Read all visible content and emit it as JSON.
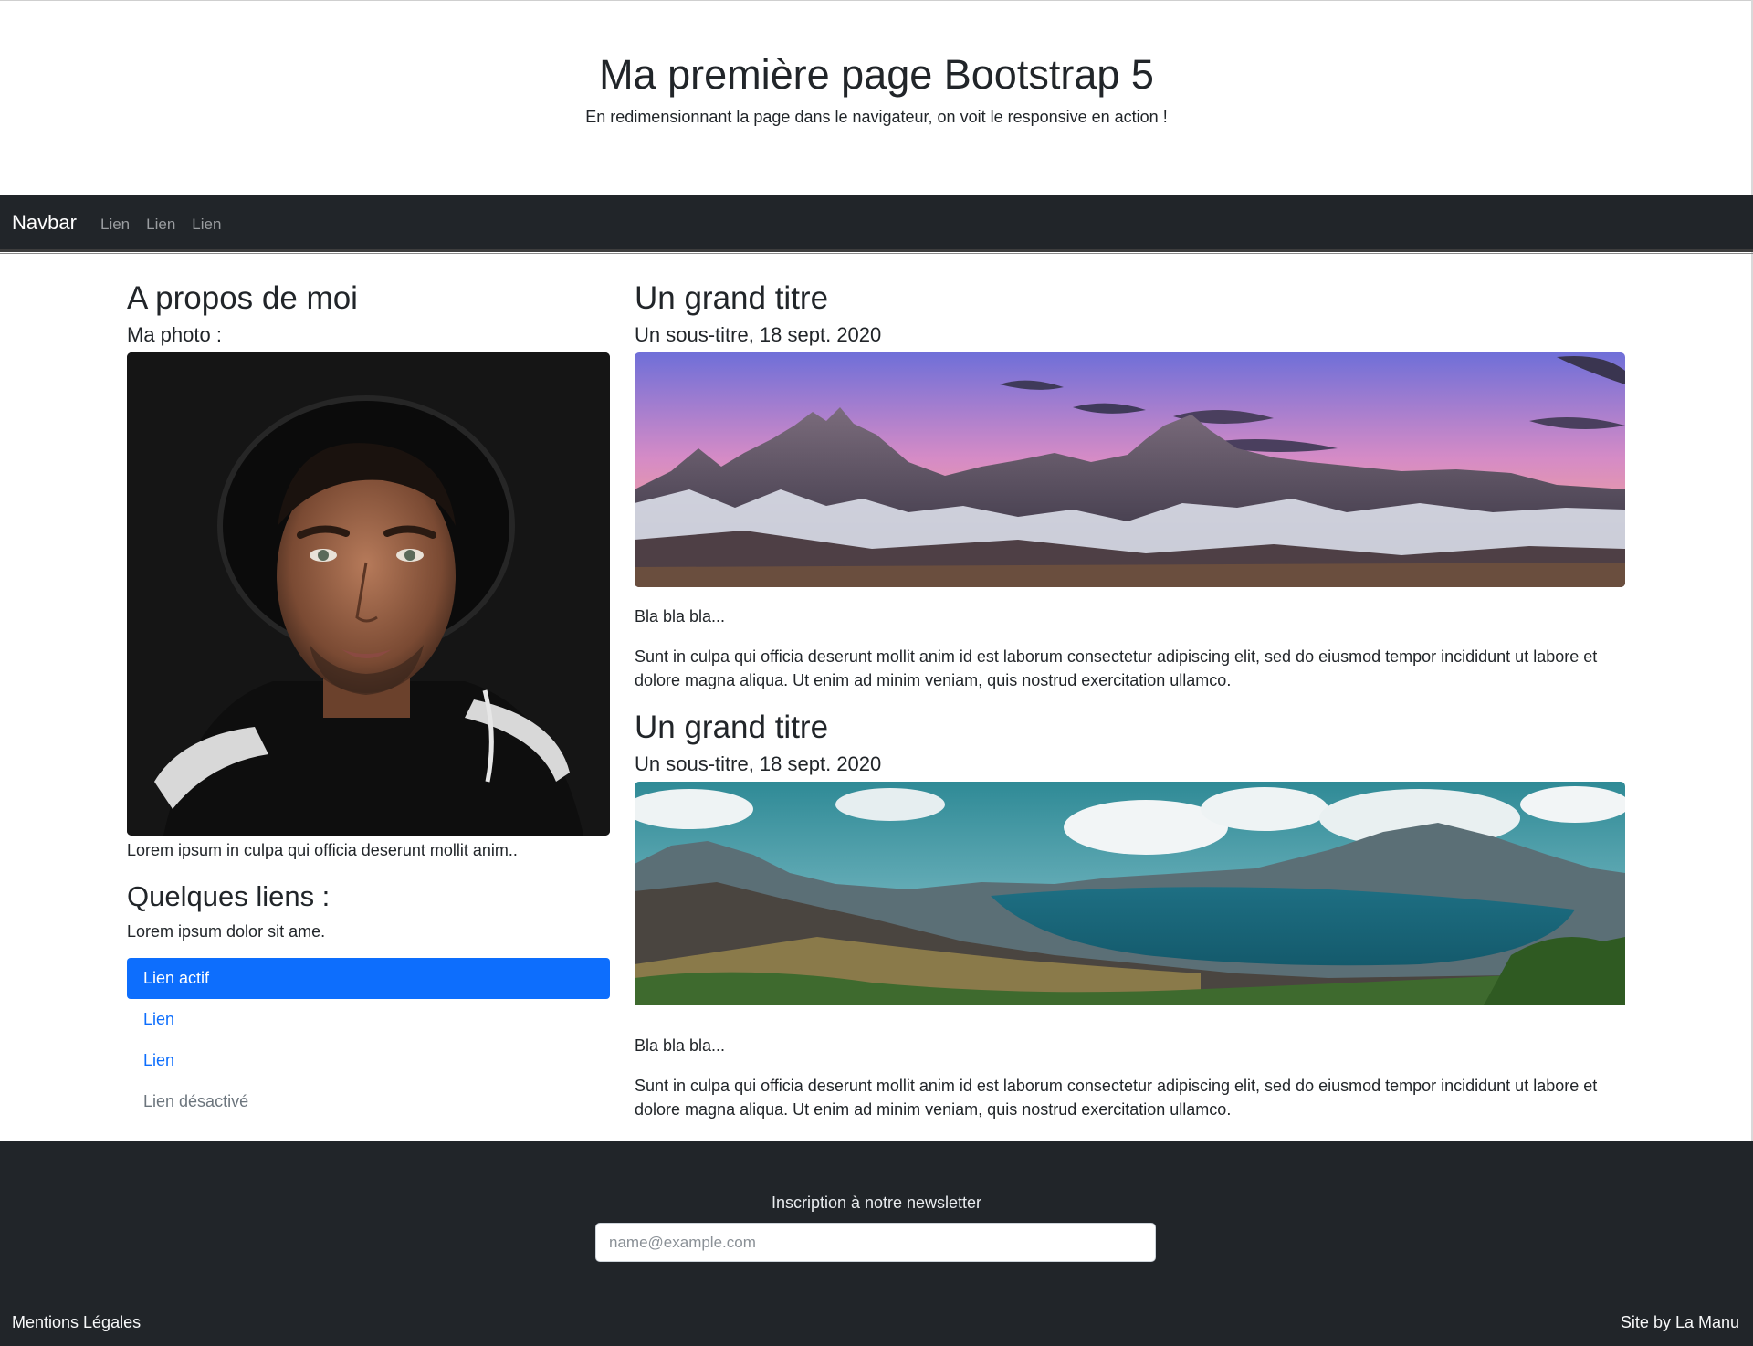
{
  "header": {
    "title": "Ma première page Bootstrap 5",
    "subtitle": "En redimensionnant la page dans le navigateur, on voit le responsive en action !"
  },
  "navbar": {
    "brand": "Navbar",
    "links": [
      "Lien",
      "Lien",
      "Lien"
    ]
  },
  "sidebar": {
    "title": "A propos de moi",
    "photo_label": "Ma photo :",
    "photo_caption": "Lorem ipsum in culpa qui officia deserunt mollit anim..",
    "links_title": "Quelques liens :",
    "links_intro": "Lorem ipsum dolor sit ame.",
    "links": [
      {
        "label": "Lien actif",
        "state": "active"
      },
      {
        "label": "Lien",
        "state": "normal"
      },
      {
        "label": "Lien",
        "state": "normal"
      },
      {
        "label": "Lien désactivé",
        "state": "disabled"
      }
    ]
  },
  "articles": [
    {
      "title": "Un grand titre",
      "subtitle": "Un sous-titre, 18 sept. 2020",
      "image": "mountain-sunset-panorama",
      "short": "Bla bla bla...",
      "body": "Sunt in culpa qui officia deserunt mollit anim id est laborum consectetur adipiscing elit, sed do eiusmod tempor incididunt ut labore et dolore magna aliqua. Ut enim ad minim veniam, quis nostrud exercitation ullamco."
    },
    {
      "title": "Un grand titre",
      "subtitle": "Un sous-titre, 18 sept. 2020",
      "image": "lake-valley-panorama",
      "short": "Bla bla bla...",
      "body": "Sunt in culpa qui officia deserunt mollit anim id est laborum consectetur adipiscing elit, sed do eiusmod tempor incididunt ut labore et dolore magna aliqua. Ut enim ad minim veniam, quis nostrud exercitation ullamco."
    }
  ],
  "footer": {
    "newsletter_label": "Inscription à notre newsletter",
    "newsletter_placeholder": "name@example.com",
    "legal": "Mentions Légales",
    "credit": "Site by La Manu"
  },
  "colors": {
    "primary": "#0d6efd",
    "dark": "#212529",
    "muted": "#6c757d"
  }
}
